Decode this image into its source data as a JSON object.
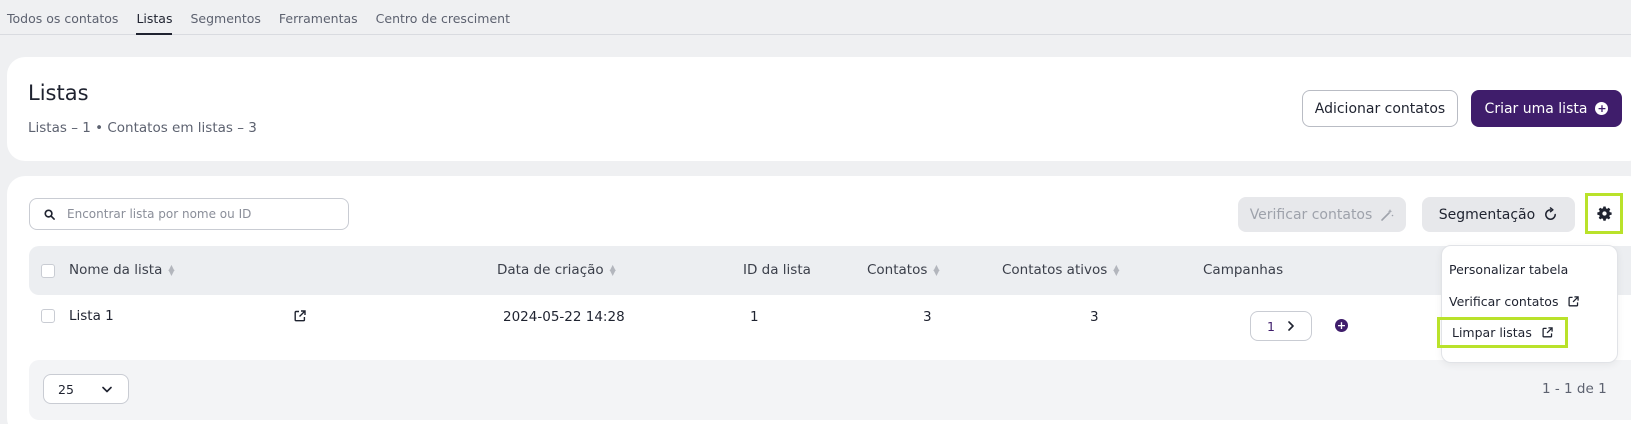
{
  "nav": {
    "tabs": [
      {
        "label": "Todos os contatos",
        "active": false
      },
      {
        "label": "Listas",
        "active": true
      },
      {
        "label": "Segmentos",
        "active": false
      },
      {
        "label": "Ferramentas",
        "active": false
      },
      {
        "label": "Centro de cresciment",
        "active": false
      }
    ]
  },
  "header": {
    "title": "Listas",
    "subtitle": "Listas – 1 • Contatos em listas – 3",
    "add_contacts_label": "Adicionar contatos",
    "create_list_label": "Criar uma lista"
  },
  "toolbar": {
    "search_placeholder": "Encontrar lista por nome ou ID",
    "verify_label": "Verificar contatos",
    "segmentation_label": "Segmentação"
  },
  "table": {
    "columns": [
      "Nome da lista",
      "Data de criação",
      "ID da lista",
      "Contatos",
      "Contatos ativos",
      "Campanhas"
    ],
    "rows": [
      {
        "name": "Lista 1",
        "created": "2024-05-22 14:28",
        "id": "1",
        "contacts": "3",
        "active_contacts": "3",
        "campaigns": "1"
      }
    ]
  },
  "footer": {
    "page_size": "25",
    "pagination": "1 - 1 de 1"
  },
  "settings_menu": {
    "items": [
      "Personalizar tabela",
      "Verificar contatos",
      "Limpar listas"
    ]
  },
  "colors": {
    "brand": "#3f1d6b",
    "highlight": "#b9e22a"
  }
}
